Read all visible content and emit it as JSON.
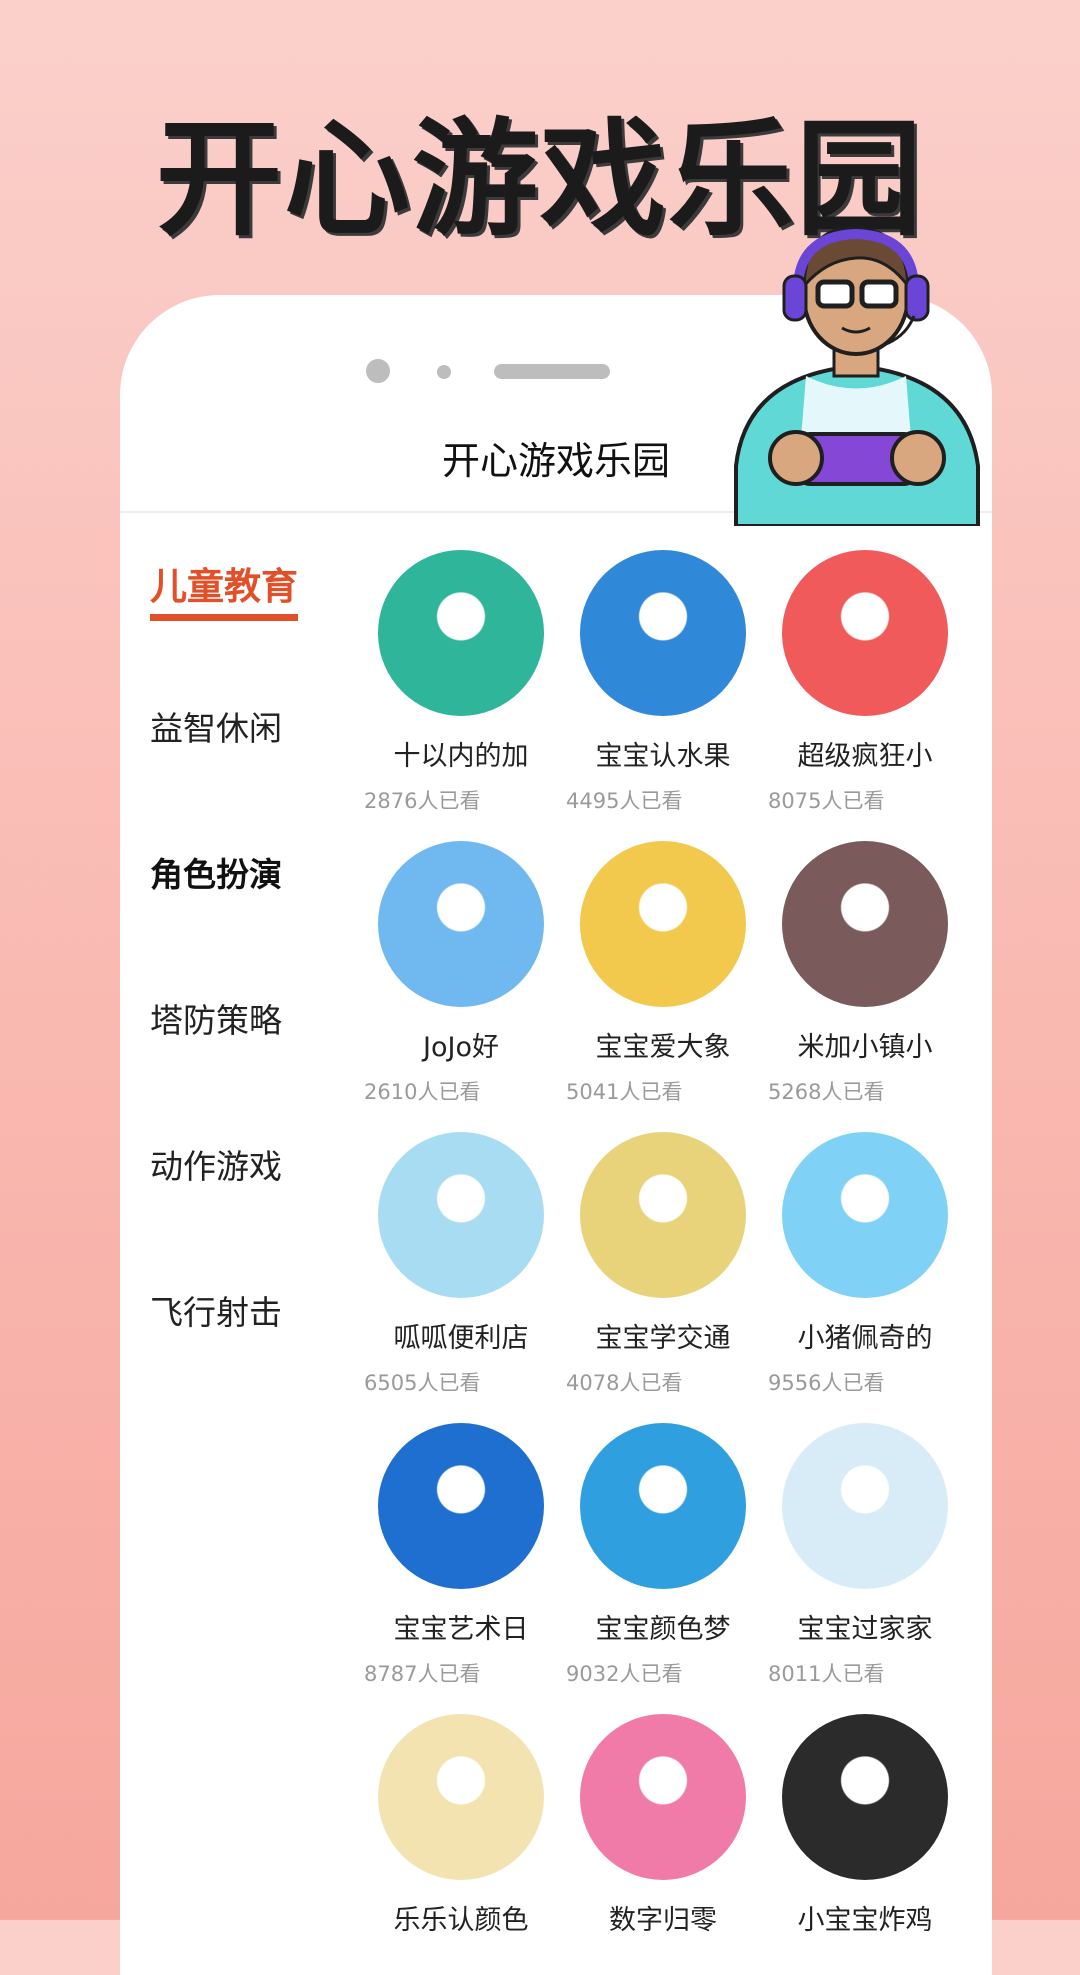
{
  "banner": {
    "title": "开心游戏乐园"
  },
  "app": {
    "title": "开心游戏乐园"
  },
  "sidebar": {
    "items": [
      {
        "label": "儿童教育"
      },
      {
        "label": "益智休闲"
      },
      {
        "label": "角色扮演"
      },
      {
        "label": "塔防策略"
      },
      {
        "label": "动作游戏"
      },
      {
        "label": "飞行射击"
      }
    ]
  },
  "games": [
    {
      "title": "十以内的加",
      "views": "2876人已看",
      "icon": "donut-lion-icon"
    },
    {
      "title": "宝宝认水果",
      "views": "4495人已看",
      "icon": "white-cat-icon"
    },
    {
      "title": "超级疯狂小",
      "views": "8075人已看",
      "icon": "dentist-girl-icon"
    },
    {
      "title": "JoJo好",
      "views": "2610人已看",
      "icon": "baby-bath-icon"
    },
    {
      "title": "宝宝爱大象",
      "views": "5041人已看",
      "icon": "elephant-icon"
    },
    {
      "title": "米加小镇小",
      "views": "5268人已看",
      "icon": "hippo-family-icon"
    },
    {
      "title": "呱呱便利店",
      "views": "6505人已看",
      "icon": "shop-icon"
    },
    {
      "title": "宝宝学交通",
      "views": "4078人已看",
      "icon": "panda-car-icon"
    },
    {
      "title": "小猪佩奇的",
      "views": "9556人已看",
      "icon": "pig-icon"
    },
    {
      "title": "宝宝艺术日",
      "views": "8787人已看",
      "icon": "panda-painter-icon"
    },
    {
      "title": "宝宝颜色梦",
      "views": "9032人已看",
      "icon": "crab-icon"
    },
    {
      "title": "宝宝过家家",
      "views": "8011人已看",
      "icon": "baby-doll-icon"
    },
    {
      "title": "乐乐认颜色",
      "views": "",
      "icon": "rainbow-icon"
    },
    {
      "title": "数字归零",
      "views": "",
      "icon": "candy-icon"
    },
    {
      "title": "小宝宝炸鸡",
      "views": "",
      "icon": "fried-chicken-icon"
    }
  ],
  "colors": {
    "accent": "#e2502a",
    "thumbs": [
      "#2fb59a",
      "#2f88d8",
      "#f05a5a",
      "#6fb9f0",
      "#f2c94c",
      "#7a5a5a",
      "#a7dcf2",
      "#e8d37a",
      "#7fd2f5",
      "#1f6fd1",
      "#2f9fe0",
      "#d7ecf7",
      "#f3e3b0",
      "#f07aa8",
      "#2b2b2b"
    ]
  }
}
